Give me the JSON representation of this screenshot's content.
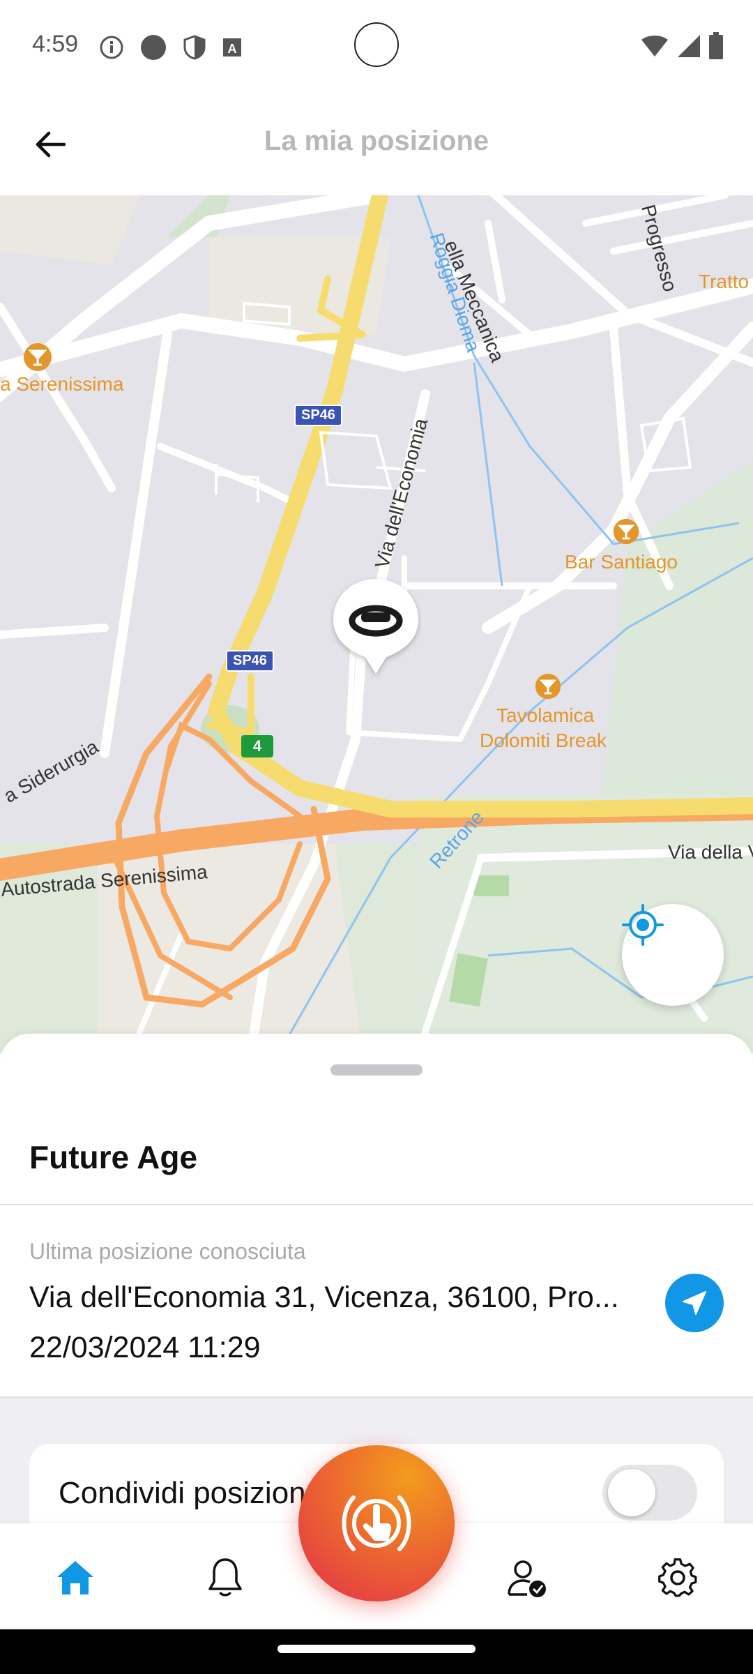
{
  "status_bar": {
    "time": "4:59",
    "icons": [
      "info-icon",
      "circle-icon",
      "shield-icon",
      "font-icon"
    ],
    "right_icons": [
      "wifi-icon",
      "signal-icon",
      "battery-icon"
    ]
  },
  "appbar": {
    "title": "La mia posizione",
    "back_icon": "arrow-left-icon"
  },
  "map": {
    "labels": {
      "serenissima_left": "a Serenissima",
      "bar_santiago": "Bar Santiago",
      "tavolamica_1": "Tavolamica",
      "tavolamica_2": "Dolomiti Break",
      "tratto": "Tratto",
      "via_meccanica": "ella Meccanica",
      "roggia_dioma": "Roggia Dioma",
      "progresso": "Progresso",
      "via_economia": "Via dell'Economia",
      "siderurgia": "a Siderurgia",
      "autostrada": "Autostrada Serenissima",
      "retrone": "Retrone",
      "via_della": "Via della V",
      "sp46_a": "SP46",
      "sp46_b": "SP46",
      "exit_4": "4"
    },
    "locate_icon": "my-location-icon",
    "device_icon": "wristband-icon"
  },
  "sheet": {
    "device_name": "Future Age",
    "caption": "Ultima posizione conosciuta",
    "address": "Via dell'Economia 31, Vicenza, 36100, Pro...",
    "date": "22/03/2024 11:29",
    "share_label": "Condividi posizione",
    "share_enabled": false
  },
  "bottom_nav": {
    "items": [
      "home-icon",
      "bell-icon",
      "sos-icon",
      "user-check-icon",
      "gear-icon"
    ],
    "active": "home-icon"
  },
  "colors": {
    "accent_blue": "#1296e6",
    "sos_orange": "#f39c1d",
    "sos_red": "#e32f49",
    "highway_orange": "#f7a964",
    "road_yellow": "#f6dc6e"
  }
}
